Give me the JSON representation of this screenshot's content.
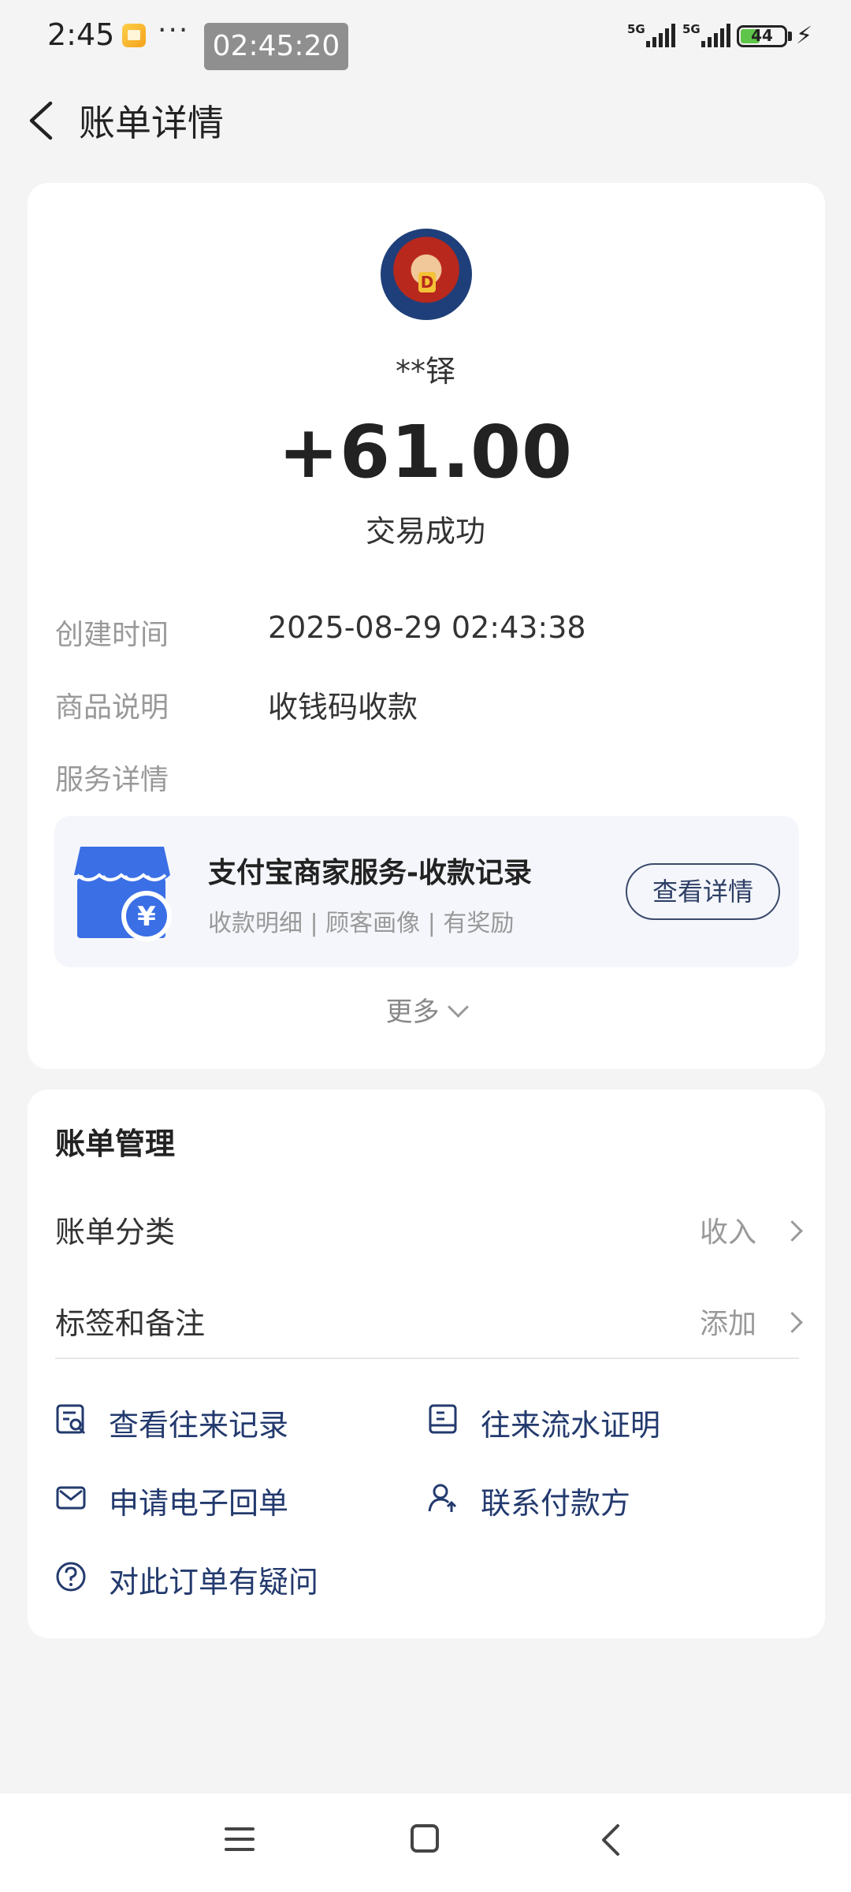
{
  "status_bar": {
    "time": "2:45",
    "dots": "···",
    "clock": "02:45:20",
    "sim1": "5G",
    "sim2": "5G",
    "battery": "44"
  },
  "header": {
    "title": "账单详情"
  },
  "bill": {
    "name": "**铎",
    "amount": "+61.00",
    "status": "交易成功",
    "created_label": "创建时间",
    "created_value": "2025-08-29 02:43:38",
    "goods_label": "商品说明",
    "goods_value": "收钱码收款",
    "service_label": "服务详情"
  },
  "service": {
    "title": "支付宝商家服务-收款记录",
    "subtitle": "收款明细 | 顾客画像 | 有奖励",
    "button": "查看详情",
    "icon": "store-yuan-icon"
  },
  "more_label": "更多",
  "management": {
    "title": "账单管理",
    "category_label": "账单分类",
    "category_value": "收入",
    "tag_label": "标签和备注",
    "tag_value": "添加",
    "actions": [
      {
        "label": "查看往来记录",
        "icon": "record-search-icon"
      },
      {
        "label": "往来流水证明",
        "icon": "document-icon"
      },
      {
        "label": "申请电子回单",
        "icon": "mail-icon"
      },
      {
        "label": "联系付款方",
        "icon": "contact-person-icon"
      },
      {
        "label": "对此订单有疑问",
        "icon": "question-icon"
      }
    ]
  },
  "colors": {
    "accent_text": "#233a6e",
    "store_blue": "#3b6fe6",
    "battery_green": "#5fc54a"
  }
}
